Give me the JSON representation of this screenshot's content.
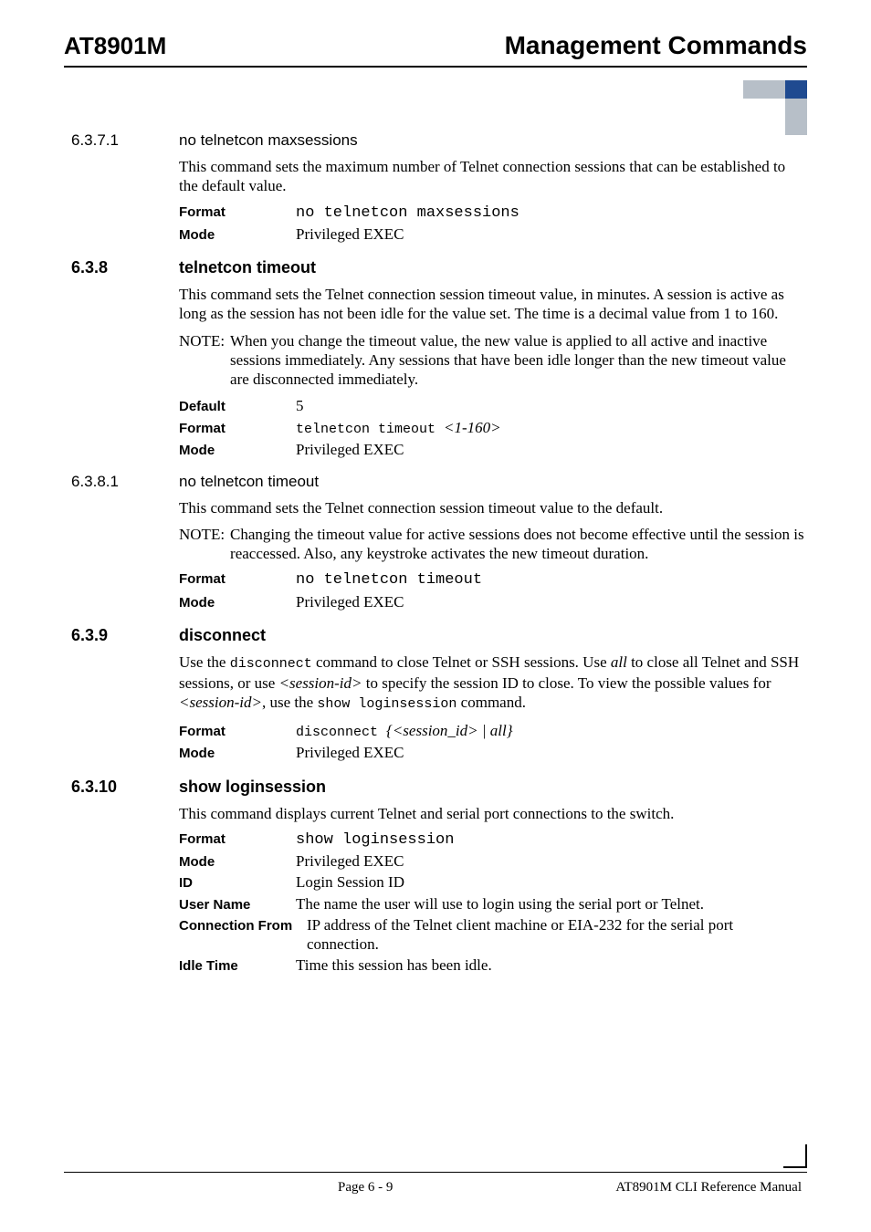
{
  "header": {
    "product": "AT8901M",
    "title": "Management Commands"
  },
  "s1": {
    "num": "6.3.7.1",
    "title": "no telnetcon maxsessions",
    "para": "This command sets the maximum number of Telnet connection sessions that can be established to the default value.",
    "format_k": "Format",
    "format_v": "no telnetcon maxsessions",
    "mode_k": "Mode",
    "mode_v": "Privileged EXEC"
  },
  "s2": {
    "num": "6.3.8",
    "title": "telnetcon timeout",
    "para": "This command sets the Telnet connection session timeout value, in minutes. A session is active as long as the session has not been idle for the value set. The time is a decimal value from 1 to 160.",
    "note_label": "NOTE:",
    "note_text": "When you change the timeout value, the new value is applied to all active and inactive sessions immediately. Any sessions that have been idle longer than the new timeout value are disconnected immediately.",
    "default_k": "Default",
    "default_v": "5",
    "format_k": "Format",
    "format_v_mono": "telnetcon timeout ",
    "format_v_ital": "<1-160>",
    "mode_k": "Mode",
    "mode_v": "Privileged EXEC"
  },
  "s3": {
    "num": "6.3.8.1",
    "title": "no telnetcon timeout",
    "para": "This command sets the Telnet connection session timeout value to the default.",
    "note_label": "NOTE:",
    "note_text": "Changing the timeout value for active sessions does not become effective until the session is reaccessed. Also, any keystroke activates the new timeout duration.",
    "format_k": "Format",
    "format_v": "no telnetcon timeout",
    "mode_k": "Mode",
    "mode_v": "Privileged EXEC"
  },
  "s4": {
    "num": "6.3.9",
    "title": "disconnect",
    "para_pre": "Use the ",
    "para_cmd1": "disconnect",
    "para_mid1": " command to close Telnet or SSH sessions. Use ",
    "para_ital1": "all",
    "para_mid2": " to close all Telnet and SSH sessions, or use ",
    "para_ital2": "<session-id>",
    "para_mid3": " to specify the session ID to close. To view the possible values for ",
    "para_ital3": "<session-id>",
    "para_mid4": ", use the ",
    "para_cmd2": "show loginsession",
    "para_end": " command.",
    "format_k": "Format",
    "format_v_mono": "disconnect ",
    "format_v_ital": "{<session_id> | all}",
    "mode_k": "Mode",
    "mode_v": "Privileged EXEC"
  },
  "s5": {
    "num": "6.3.10",
    "title": "show loginsession",
    "para": "This command displays current Telnet and serial port connections to the switch.",
    "format_k": "Format",
    "format_v": "show loginsession",
    "mode_k": "Mode",
    "mode_v": "Privileged EXEC",
    "id_k": "ID",
    "id_v": "Login Session ID",
    "user_k": "User Name",
    "user_v": "The name the user will use to login using the serial port or Telnet.",
    "conn_k": "Connection From",
    "conn_v": "IP address of the Telnet client machine or EIA-232 for the serial port connection.",
    "idle_k": "Idle Time",
    "idle_v": "Time this session has been idle."
  },
  "footer": {
    "page": "Page 6 - 9",
    "doc": "AT8901M CLI Reference Manual"
  }
}
